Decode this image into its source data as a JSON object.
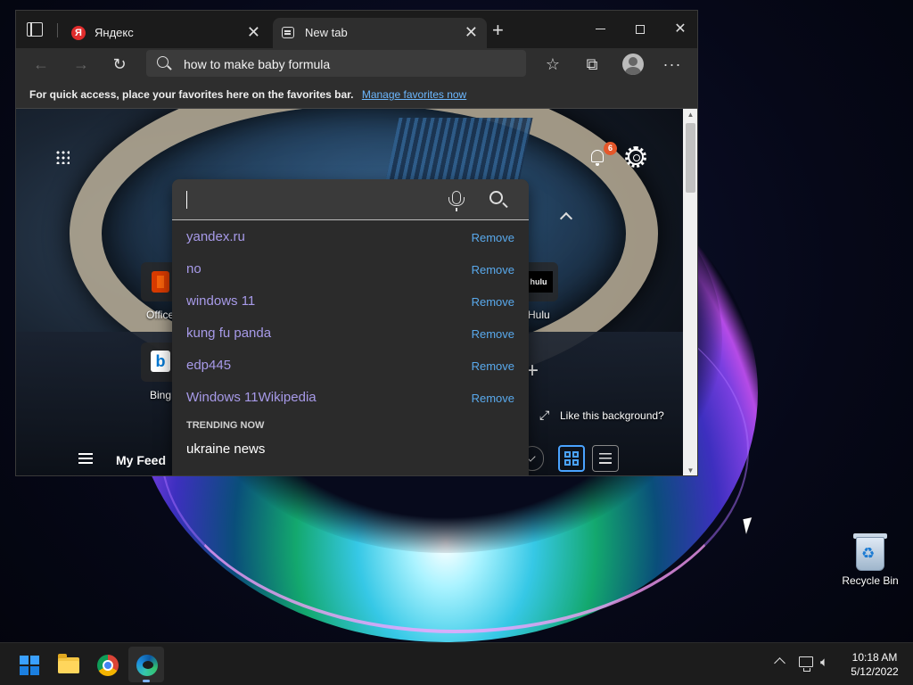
{
  "browser": {
    "tabs": [
      {
        "title": "Яндекс",
        "favicon": "yandex-icon",
        "active": false
      },
      {
        "title": "New tab",
        "favicon": "new-tab-icon",
        "active": true
      }
    ],
    "address": "how to make baby formula",
    "favorites_bar": {
      "message": "For quick access, place your favorites here on the favorites bar.",
      "link": "Manage favorites now"
    }
  },
  "newtab": {
    "notification_count": "6",
    "quick_links": [
      {
        "label": "Office",
        "icon": "office-icon"
      },
      {
        "label": "Bing",
        "icon": "bing-icon"
      },
      {
        "label": "Hulu",
        "icon": "hulu-icon"
      }
    ],
    "hulu_logo_text": "hulu",
    "bing_logo_text": "b",
    "like_background": "Like this background?",
    "my_feed": "My Feed"
  },
  "search": {
    "history": [
      {
        "query": "yandex.ru",
        "action": "Remove"
      },
      {
        "query": "no",
        "action": "Remove"
      },
      {
        "query": "windows 11",
        "action": "Remove"
      },
      {
        "query": "kung fu panda",
        "action": "Remove"
      },
      {
        "query": "edp445",
        "action": "Remove"
      },
      {
        "query": "Windows 11Wikipedia",
        "action": "Remove"
      }
    ],
    "trending_title": "TRENDING NOW",
    "trending": [
      "ukraine news"
    ]
  },
  "desktop": {
    "recycle_bin_label": "Recycle Bin"
  },
  "taskbar": {
    "apps": [
      "start-icon",
      "file-explorer-icon",
      "chrome-icon",
      "edge-icon"
    ],
    "time": "10:18 AM",
    "date": "5/12/2022"
  },
  "colors": {
    "accent": "#4aa3ff",
    "history_text": "#a79ae8",
    "remove_link": "#59a9ec",
    "badge": "#e5572a"
  }
}
